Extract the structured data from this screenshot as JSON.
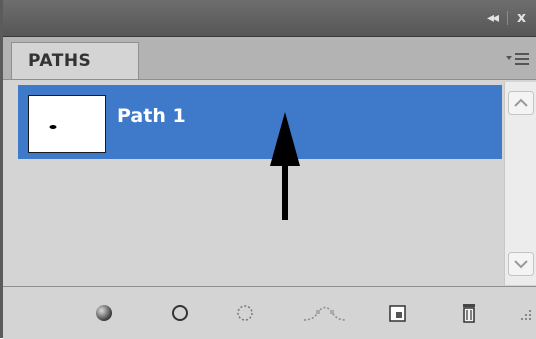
{
  "titlebar": {
    "collapse_label": "◂◂",
    "close_label": "x"
  },
  "tabs": [
    {
      "label": "PATHS"
    }
  ],
  "paths": [
    {
      "name": "Path 1",
      "selected": true
    }
  ],
  "footer_buttons": [
    {
      "icon": "fill-path-icon",
      "title": "Fill path with foreground color"
    },
    {
      "icon": "stroke-path-icon",
      "title": "Stroke path with brush"
    },
    {
      "icon": "load-selection-icon",
      "title": "Load path as a selection"
    },
    {
      "icon": "make-work-path-icon",
      "title": "Make work path from selection"
    },
    {
      "icon": "new-path-icon",
      "title": "Create new path"
    },
    {
      "icon": "trash-icon",
      "title": "Delete current path"
    }
  ],
  "colors": {
    "selection": "#3f79c9",
    "titlebar": "#5e5e5e",
    "panel": "#d4d4d4"
  }
}
